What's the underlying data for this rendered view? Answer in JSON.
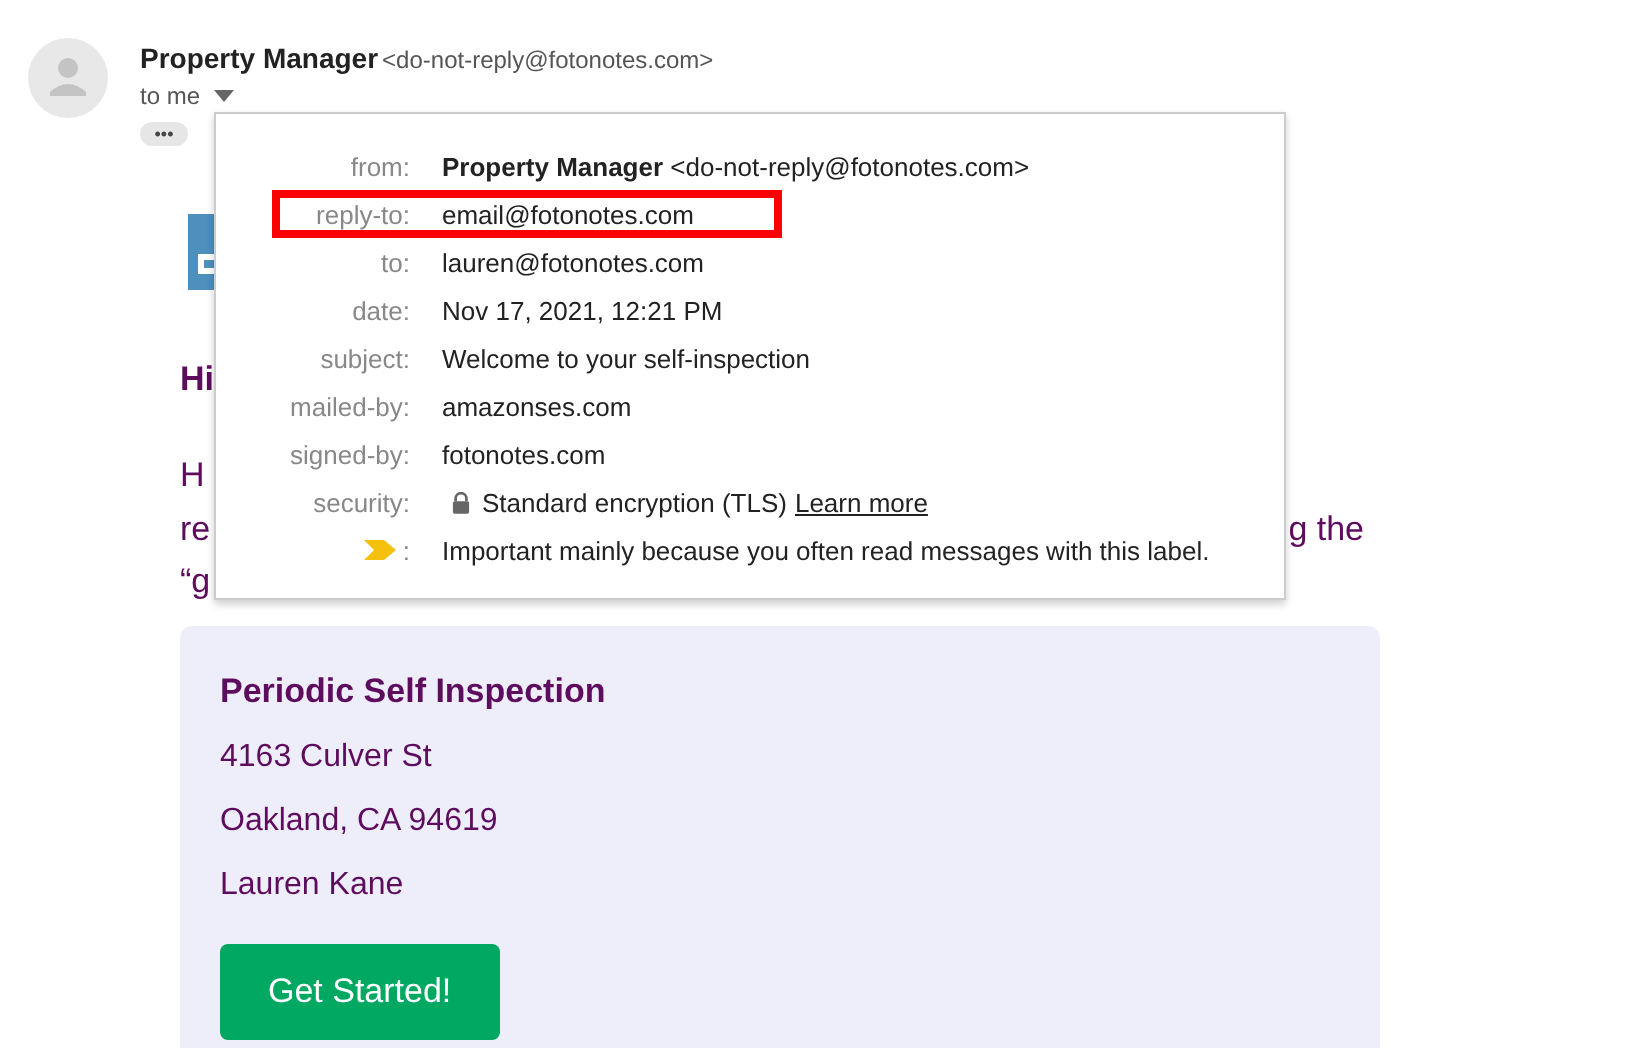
{
  "header": {
    "sender_name": "Property Manager",
    "sender_email": "<do-not-reply@fotonotes.com>",
    "recipient": "to me",
    "more": "•••"
  },
  "details": [
    {
      "kind": "sender",
      "label": "from:",
      "name": "Property Manager",
      "value": "<do-not-reply@fotonotes.com>",
      "highlighted": false
    },
    {
      "kind": "text",
      "label": "reply-to:",
      "value": "email@fotonotes.com",
      "highlighted": true
    },
    {
      "kind": "text",
      "label": "to:",
      "value": "lauren@fotonotes.com",
      "highlighted": false
    },
    {
      "kind": "text",
      "label": "date:",
      "value": "Nov 17, 2021, 12:21 PM",
      "highlighted": false
    },
    {
      "kind": "text",
      "label": "subject:",
      "value": "Welcome to your self-inspection",
      "highlighted": false
    },
    {
      "kind": "text",
      "label": "mailed-by:",
      "value": "amazonses.com",
      "highlighted": false
    },
    {
      "kind": "text",
      "label": "signed-by:",
      "value": "fotonotes.com",
      "highlighted": false
    },
    {
      "kind": "security",
      "label": "security:",
      "value": "Standard encryption (TLS)",
      "link": "Learn more",
      "highlighted": false
    },
    {
      "kind": "importance",
      "label": ":",
      "value": "Important mainly because you often read messages with this label.",
      "highlighted": false
    }
  ],
  "body": {
    "greeting": "Hi",
    "line_1": "H",
    "line_2_start": "re",
    "line_2_end": "g the",
    "line_3": "“g"
  },
  "card": {
    "title": "Periodic Self Inspection",
    "lines": [
      "4163 Culver St",
      "Oakland, CA 94619",
      "Lauren Kane"
    ],
    "button": "Get Started!"
  }
}
